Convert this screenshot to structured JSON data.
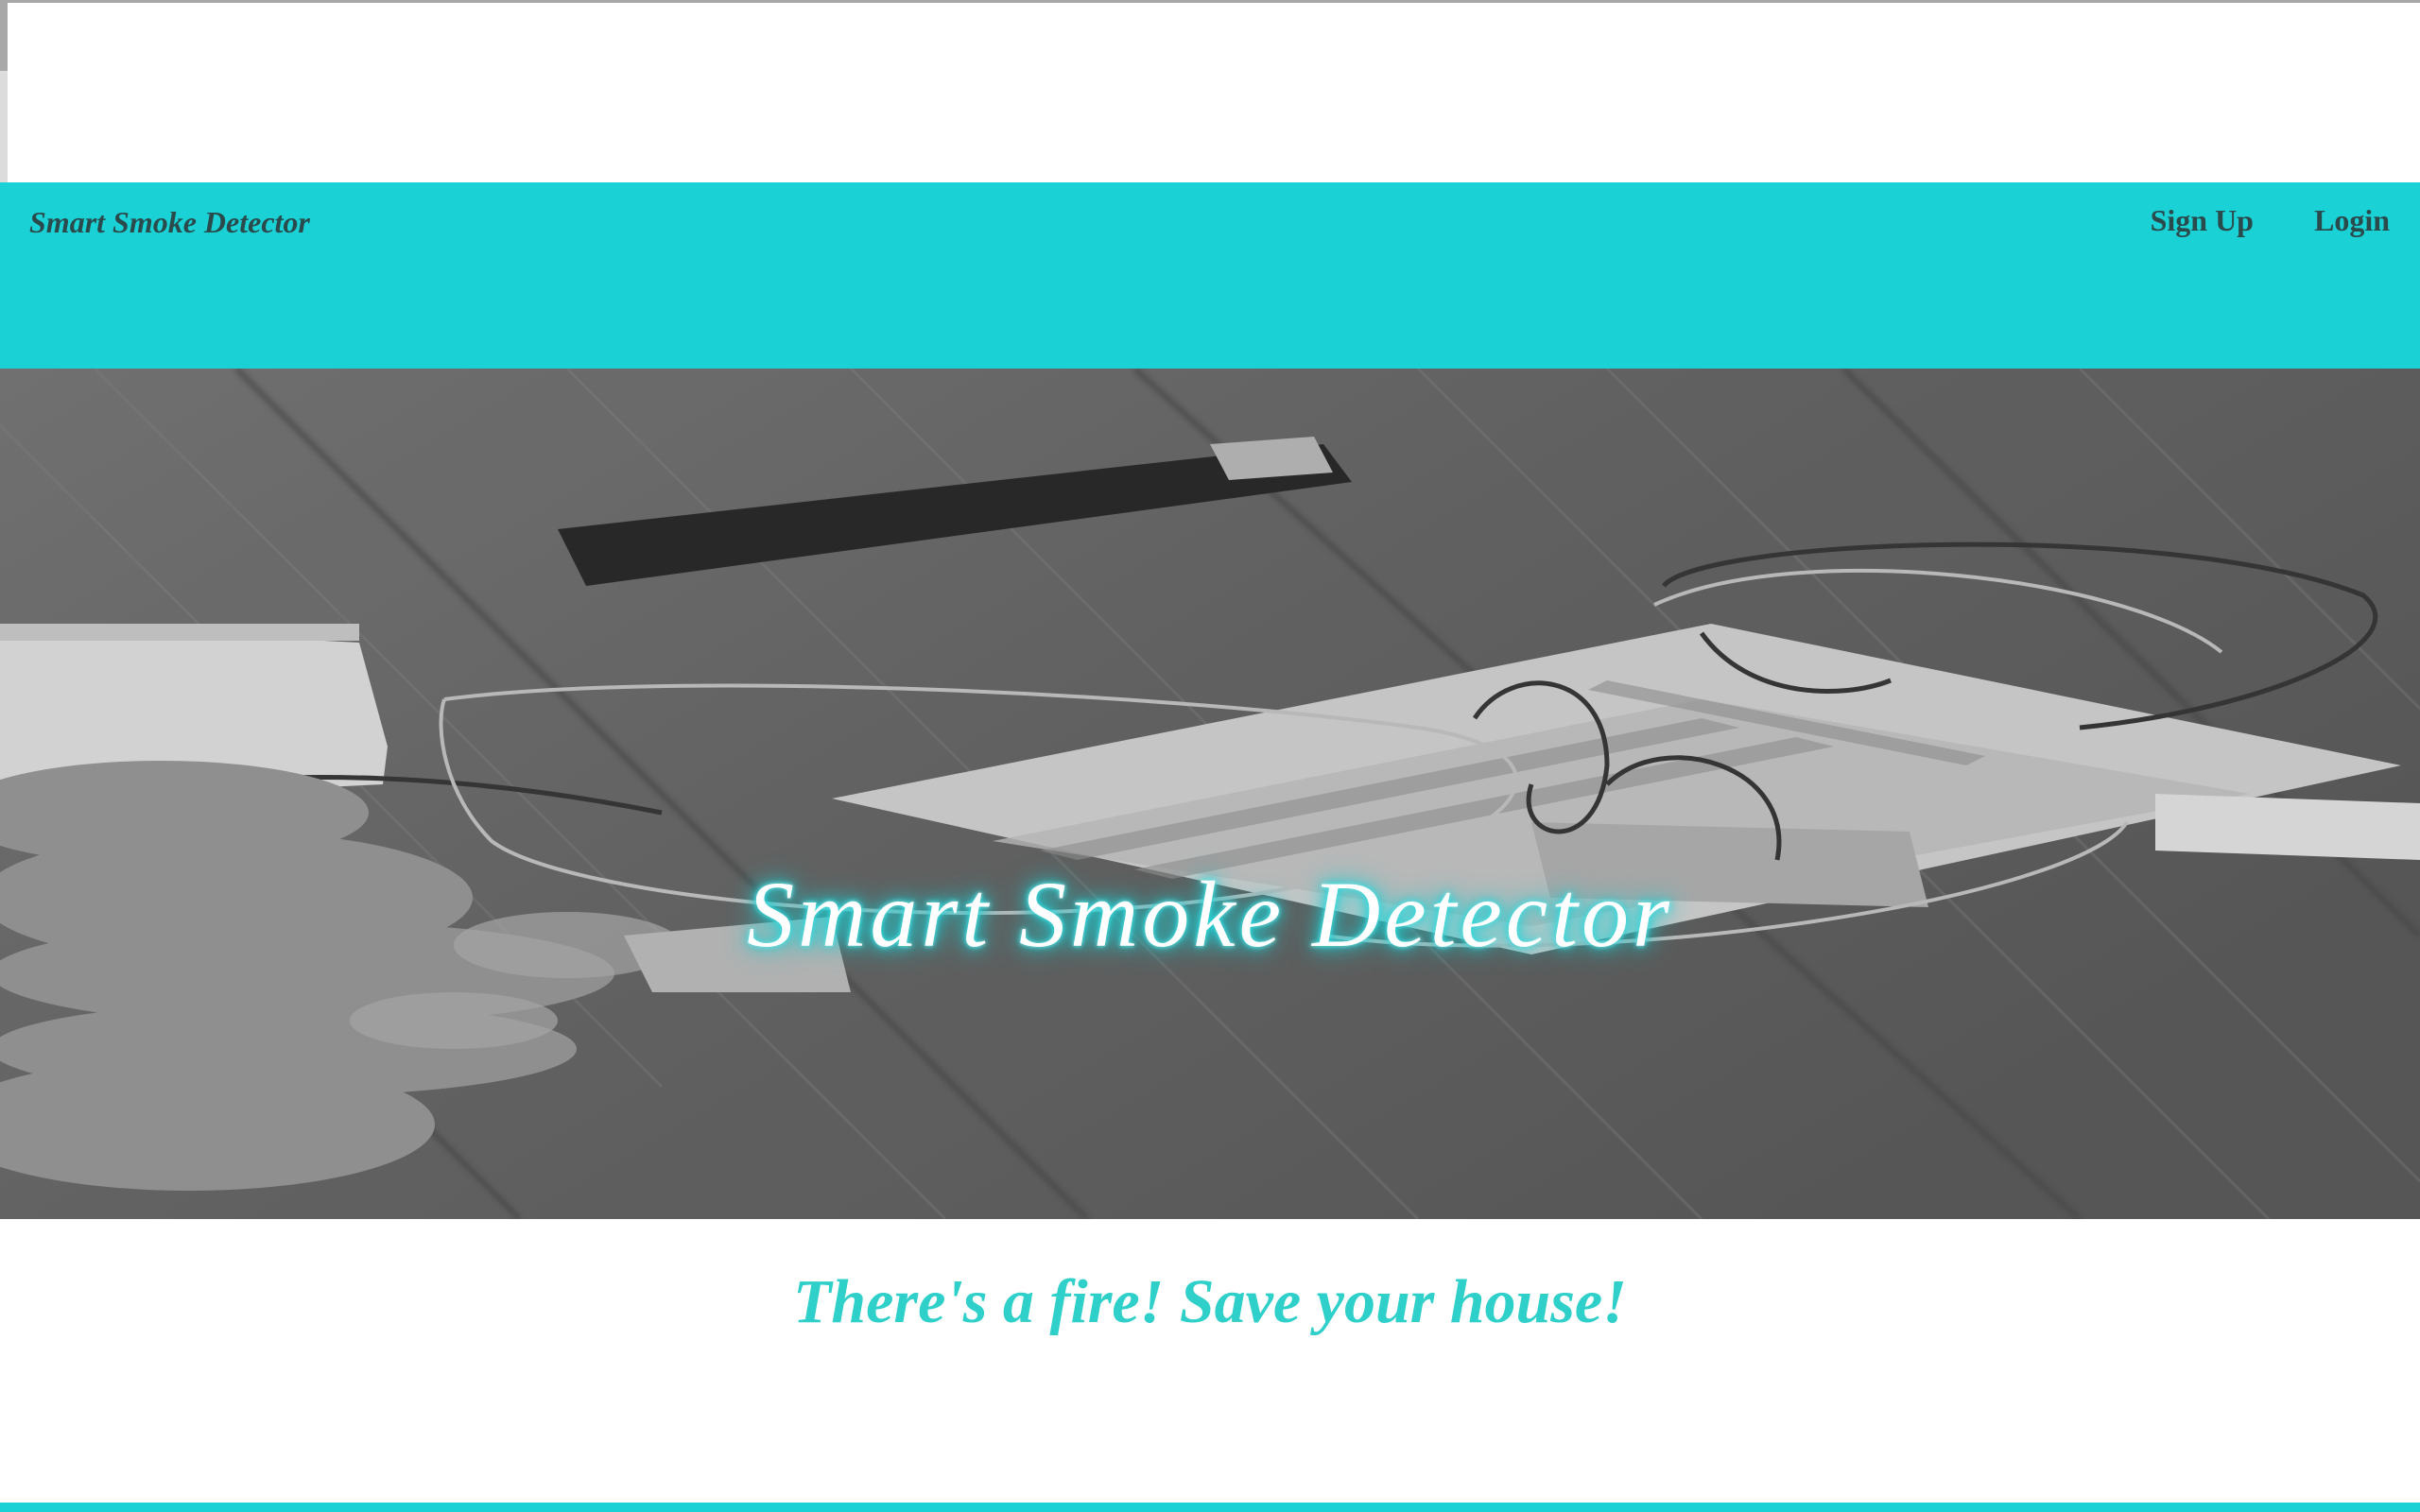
{
  "navbar": {
    "brand": "Smart Smoke Detector",
    "links": [
      {
        "label": "Sign Up"
      },
      {
        "label": "Login"
      }
    ]
  },
  "hero": {
    "title": "Smart Smoke Detector"
  },
  "tagline": "There's a fire! Save your house!",
  "colors": {
    "accent": "#1ad2d6",
    "nav_text": "#2a4a4c",
    "tagline": "#2fcfca"
  }
}
